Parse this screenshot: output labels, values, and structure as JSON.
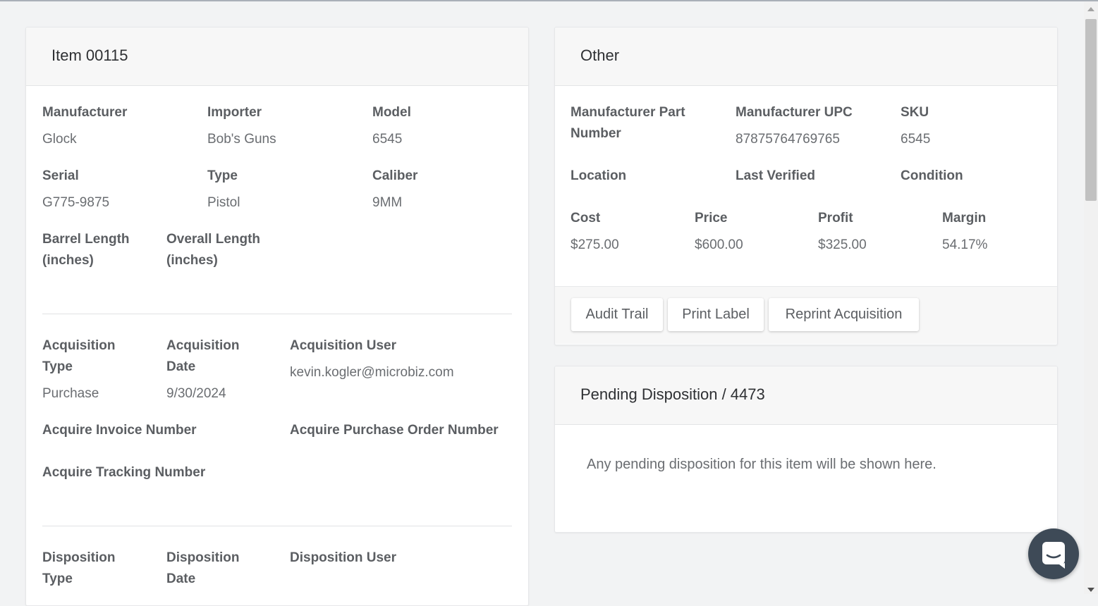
{
  "item_card": {
    "title": "Item 00115",
    "fields": {
      "manufacturer": {
        "label": "Manufacturer",
        "value": "Glock"
      },
      "importer": {
        "label": "Importer",
        "value": "Bob's Guns"
      },
      "model": {
        "label": "Model",
        "value": "6545"
      },
      "serial": {
        "label": "Serial",
        "value": "G775-9875"
      },
      "type": {
        "label": "Type",
        "value": "Pistol"
      },
      "caliber": {
        "label": "Caliber",
        "value": "9MM"
      },
      "barrel_length": {
        "label_line1": "Barrel Length",
        "label_line2": "(inches)"
      },
      "overall_length": {
        "label_line1": "Overall Length",
        "label_line2": "(inches)"
      }
    },
    "acquisition": {
      "type": {
        "label_line1": "Acquisition",
        "label_line2": "Type",
        "value": "Purchase"
      },
      "date": {
        "label_line1": "Acquisition",
        "label_line2": "Date",
        "value": "9/30/2024"
      },
      "user": {
        "label": "Acquisition User",
        "value": "kevin.kogler@microbiz.com"
      },
      "invoice_number": {
        "label": "Acquire Invoice Number"
      },
      "po_number": {
        "label": "Acquire Purchase Order Number"
      },
      "tracking_number": {
        "label": "Acquire Tracking Number"
      }
    },
    "disposition": {
      "type": {
        "label_line1": "Disposition",
        "label_line2": "Type"
      },
      "date": {
        "label_line1": "Disposition",
        "label_line2": "Date"
      },
      "user": {
        "label": "Disposition User"
      }
    }
  },
  "other_card": {
    "title": "Other",
    "fields": {
      "mfr_part_number": {
        "label_line1": "Manufacturer Part",
        "label_line2": "Number"
      },
      "mfr_upc": {
        "label": "Manufacturer UPC",
        "value": "87875764769765"
      },
      "sku": {
        "label": "SKU",
        "value": "6545"
      },
      "location": {
        "label": "Location"
      },
      "last_verified": {
        "label": "Last Verified"
      },
      "condition": {
        "label": "Condition"
      },
      "cost": {
        "label": "Cost",
        "value": "$275.00"
      },
      "price": {
        "label": "Price",
        "value": "$600.00"
      },
      "profit": {
        "label": "Profit",
        "value": "$325.00"
      },
      "margin": {
        "label": "Margin",
        "value": "54.17%"
      }
    },
    "buttons": {
      "audit_trail": "Audit Trail",
      "print_label": "Print Label",
      "reprint_acquisition": "Reprint Acquisition"
    }
  },
  "pending_card": {
    "title": "Pending Disposition / 4473",
    "message": "Any pending disposition for this item will be shown here."
  },
  "icons": {
    "chat": "chat-bubble-icon",
    "scroll_up": "scroll-up-arrow-icon",
    "scroll_down": "scroll-down-arrow-icon"
  },
  "colors": {
    "page_bg": "#f2f3f4",
    "card_header_bg": "#f7f7f7",
    "chat_button": "#3e4a57"
  }
}
